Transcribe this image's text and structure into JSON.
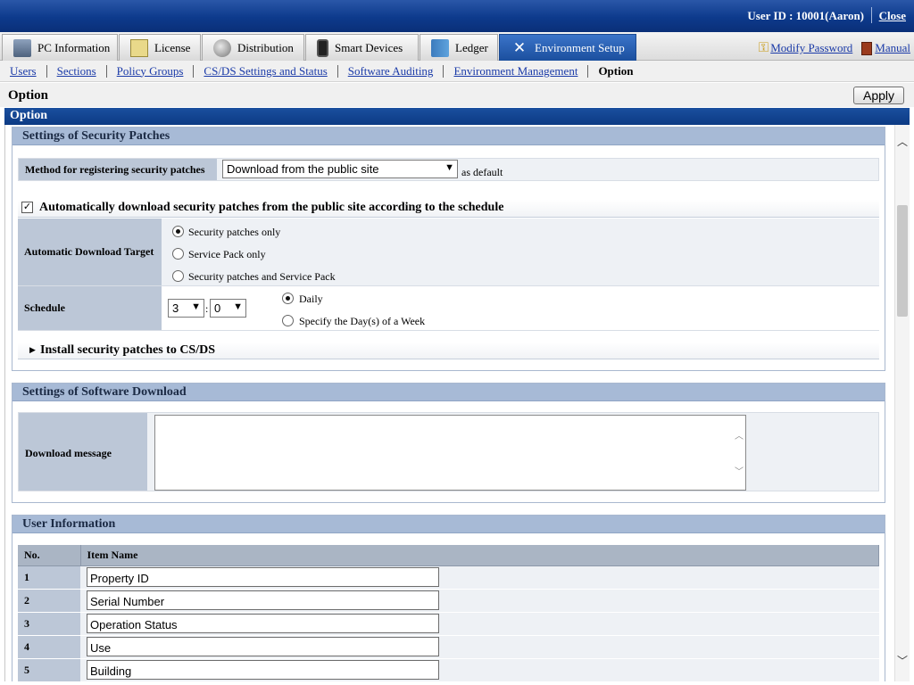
{
  "header": {
    "user_id": "User ID : 10001(Aaron)",
    "close": "Close"
  },
  "tabs": [
    {
      "label": "PC Information",
      "icon": "pc-icon"
    },
    {
      "label": "License",
      "icon": "license-icon"
    },
    {
      "label": "Distribution",
      "icon": "distribution-icon"
    },
    {
      "label": "Smart Devices",
      "icon": "smart-device-icon"
    },
    {
      "label": "Ledger",
      "icon": "ledger-icon"
    },
    {
      "label": "Environment Setup",
      "icon": "tools-icon",
      "active": true
    }
  ],
  "right_links": {
    "modify_password": "Modify Password",
    "manual": "Manual"
  },
  "subnav": {
    "users": "Users",
    "sections": "Sections",
    "policy_groups": "Policy Groups",
    "csds": "CS/DS Settings and Status",
    "software_auditing": "Software Auditing",
    "environment_management": "Environment Management",
    "current": "Option"
  },
  "page": {
    "title": "Option",
    "apply": "Apply",
    "section_header": "Option"
  },
  "security_patches": {
    "header": "Settings of Security Patches",
    "method_label": "Method for registering security patches",
    "method_value": "Download from the public site",
    "as_default": "as default",
    "auto_download_label": "Automatically download security patches from the public site according to the schedule",
    "auto_download_checked": true,
    "target_label": "Automatic Download Target",
    "target_options": [
      "Security patches only",
      "Service Pack only",
      "Security patches and Service Pack"
    ],
    "target_selected": 0,
    "schedule_label": "Schedule",
    "schedule_hour": "3",
    "schedule_minute": "0",
    "schedule_options": [
      "Daily",
      "Specify the Day(s) of a Week"
    ],
    "schedule_selected": 0,
    "install_label": "Install security patches to CS/DS"
  },
  "software_download": {
    "header": "Settings of Software Download",
    "message_label": "Download message",
    "message_value": ""
  },
  "user_information": {
    "header": "User Information",
    "col_no": "No.",
    "col_item": "Item Name",
    "rows": [
      {
        "no": "1",
        "name": "Property ID"
      },
      {
        "no": "2",
        "name": "Serial Number"
      },
      {
        "no": "3",
        "name": "Operation Status"
      },
      {
        "no": "4",
        "name": "Use"
      },
      {
        "no": "5",
        "name": "Building"
      }
    ]
  },
  "colors": {
    "header_blue": "#0d3a8c",
    "section_head": "#a7bad6",
    "label_cell": "#bcc7d7",
    "link": "#1a3aa8"
  }
}
